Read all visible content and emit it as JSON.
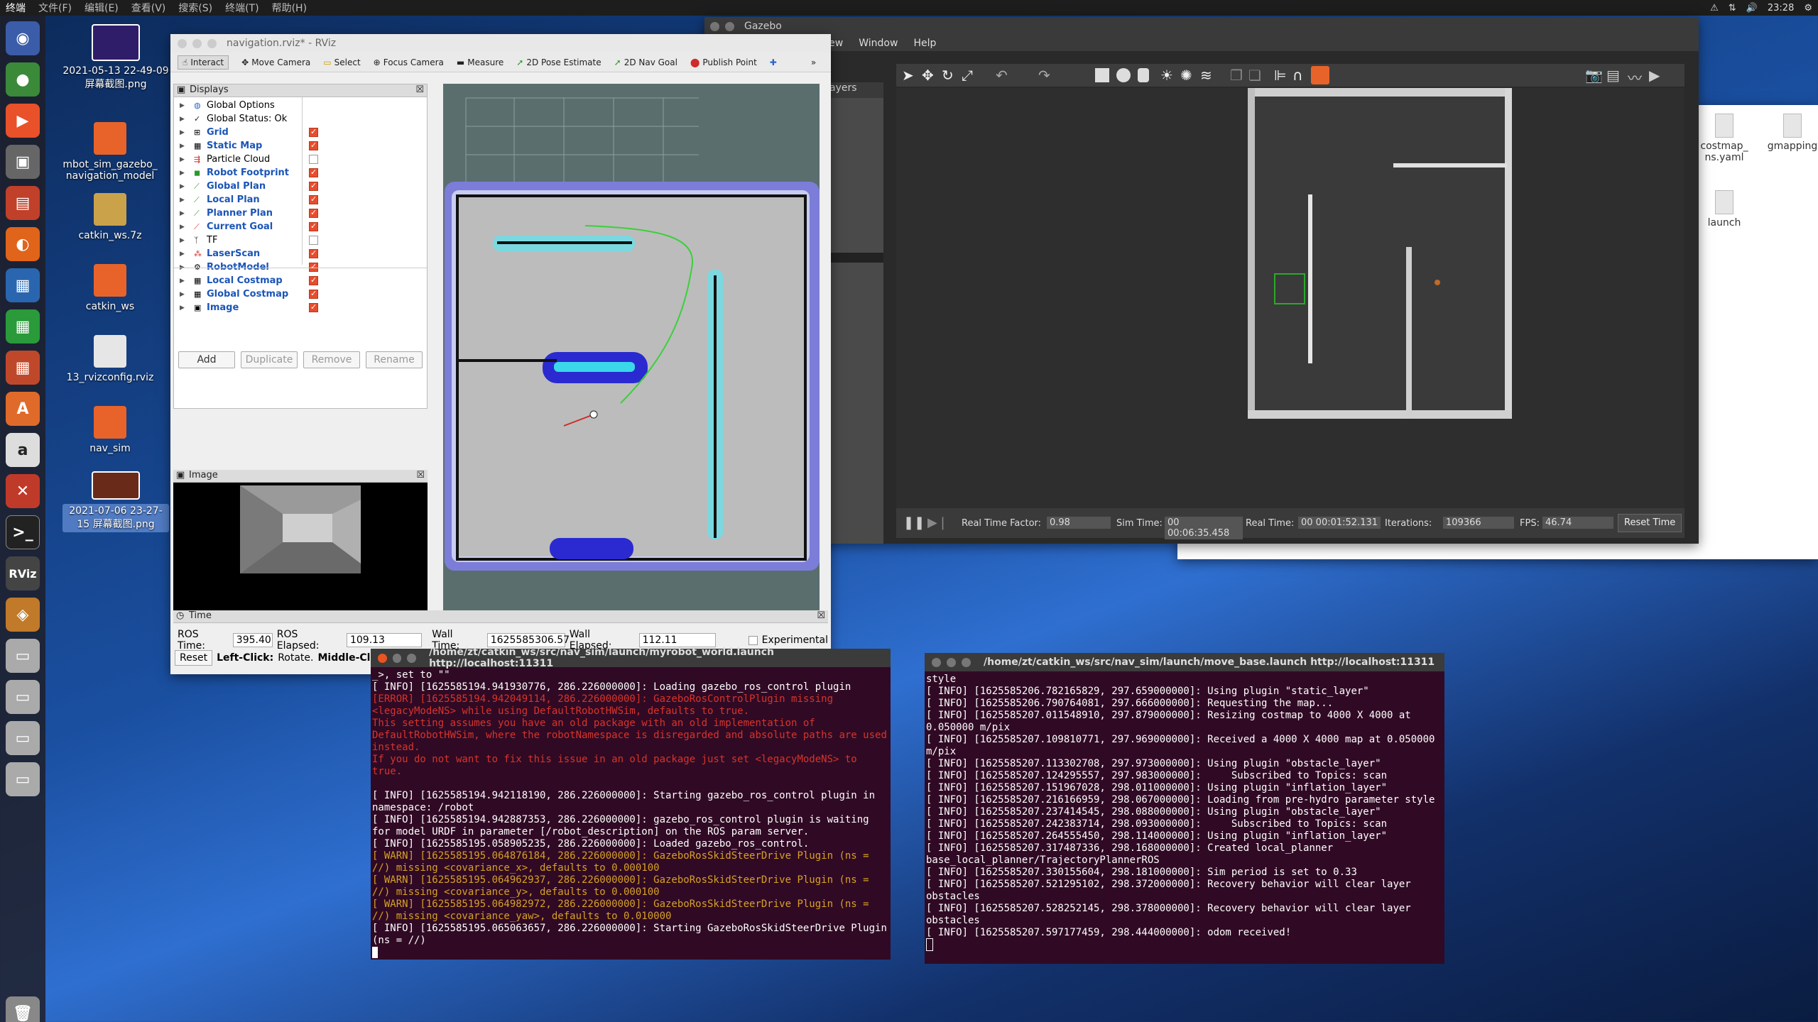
{
  "topbar": {
    "app": "终端",
    "menus": [
      "终端",
      "文件(F)",
      "编辑(E)",
      "查看(V)",
      "搜索(S)",
      "终端(T)",
      "帮助(H)"
    ],
    "time": "23:28"
  },
  "desktop": {
    "icons": [
      {
        "label": "2021-05-13 22-49-09 屏幕截图.png"
      },
      {
        "label": "mbot_sim_gazebo_ navigation_model"
      },
      {
        "label": "catkin_ws.7z"
      },
      {
        "label": "catkin_ws"
      },
      {
        "label": "13_rvizconfig.rviz"
      },
      {
        "label": "nav_sim"
      },
      {
        "label": "2021-07-06 23-27-15 屏幕截图.png"
      }
    ],
    "right_icons": [
      {
        "label": "costmap_ ns.yaml"
      },
      {
        "label": "gmapping"
      },
      {
        "label": "launch"
      }
    ]
  },
  "rviz": {
    "title": "navigation.rviz* - RViz",
    "tools": [
      "Interact",
      "Move Camera",
      "Select",
      "Focus Camera",
      "Measure",
      "2D Pose Estimate",
      "2D Nav Goal",
      "Publish Point"
    ],
    "displays_title": "Displays",
    "displays": [
      {
        "name": "Global Options",
        "checked": null,
        "blue": false
      },
      {
        "name": "Global Status: Ok",
        "checked": null,
        "blue": false
      },
      {
        "name": "Grid",
        "checked": true,
        "blue": true
      },
      {
        "name": "Static Map",
        "checked": true,
        "blue": true
      },
      {
        "name": "Particle Cloud",
        "checked": false,
        "blue": false
      },
      {
        "name": "Robot Footprint",
        "checked": true,
        "blue": true
      },
      {
        "name": "Global Plan",
        "checked": true,
        "blue": true
      },
      {
        "name": "Local Plan",
        "checked": true,
        "blue": true
      },
      {
        "name": "Planner Plan",
        "checked": true,
        "blue": true
      },
      {
        "name": "Current Goal",
        "checked": true,
        "blue": true
      },
      {
        "name": "TF",
        "checked": false,
        "blue": false
      },
      {
        "name": "LaserScan",
        "checked": true,
        "blue": true
      },
      {
        "name": "RobotModel",
        "checked": true,
        "blue": true
      },
      {
        "name": "Local Costmap",
        "checked": true,
        "blue": true
      },
      {
        "name": "Global Costmap",
        "checked": true,
        "blue": true
      },
      {
        "name": "Image",
        "checked": true,
        "blue": true
      }
    ],
    "buttons": {
      "add": "Add",
      "duplicate": "Duplicate",
      "remove": "Remove",
      "rename": "Rename"
    },
    "image_panel_title": "Image",
    "time_panel_title": "Time",
    "time": {
      "ros_time_label": "ROS Time:",
      "ros_time": "395.40",
      "ros_elapsed_label": "ROS Elapsed:",
      "ros_elapsed": "109.13",
      "wall_time_label": "Wall Time:",
      "wall_time": "1625585306.57",
      "wall_elapsed_label": "Wall Elapsed:",
      "wall_elapsed": "112.11",
      "experimental": "Experimental"
    },
    "status": {
      "reset": "Reset",
      "hint_bold": "Left-Click:",
      "hint_1": "Rotate.",
      "hint_bold2": "Middle-Click:"
    }
  },
  "gazebo": {
    "title": "Gazebo",
    "menus": [
      "View",
      "Window",
      "Help"
    ],
    "side_label": "ayers",
    "status": {
      "rtf_label": "Real Time Factor:",
      "rtf": "0.98",
      "sim_label": "Sim Time:",
      "sim": "00 00:06:35.458",
      "real_label": "Real Time:",
      "real": "00 00:01:52.131",
      "iter_label": "Iterations:",
      "iter": "109366",
      "fps_label": "FPS:",
      "fps": "46.74",
      "reset": "Reset Time"
    }
  },
  "term1": {
    "title": "/home/zt/catkin_ws/src/nav_sim/launch/myrobot_world.launch http://localhost:11311",
    "lines": [
      {
        "t": "_>, set to \"\"",
        "c": ""
      },
      {
        "t": "[ INFO] [1625585194.941930776, 286.226000000]: Loading gazebo_ros_control plugin",
        "c": ""
      },
      {
        "t": "[ERROR] [1625585194.942049114, 286.226000000]: GazeboRosControlPlugin missing <legacyModeNS> while using DefaultRobotHWSim, defaults to true.",
        "c": "err"
      },
      {
        "t": "This setting assumes you have an old package with an old implementation of DefaultRobotHWSim, where the robotNamespace is disregarded and absolute paths are used instead.",
        "c": "err"
      },
      {
        "t": "If you do not want to fix this issue in an old package just set <legacyModeNS> to true.",
        "c": "err"
      },
      {
        "t": "",
        "c": ""
      },
      {
        "t": "[ INFO] [1625585194.942118190, 286.226000000]: Starting gazebo_ros_control plugin in namespace: /robot",
        "c": ""
      },
      {
        "t": "[ INFO] [1625585194.942887353, 286.226000000]: gazebo_ros_control plugin is waiting for model URDF in parameter [/robot_description] on the ROS param server.",
        "c": ""
      },
      {
        "t": "[ INFO] [1625585195.058905235, 286.226000000]: Loaded gazebo_ros_control.",
        "c": ""
      },
      {
        "t": "[ WARN] [1625585195.064876184, 286.226000000]: GazeboRosSkidSteerDrive Plugin (ns = //) missing <covariance_x>, defaults to 0.000100",
        "c": "warn"
      },
      {
        "t": "[ WARN] [1625585195.064962937, 286.226000000]: GazeboRosSkidSteerDrive Plugin (ns = //) missing <covariance_y>, defaults to 0.000100",
        "c": "warn"
      },
      {
        "t": "[ WARN] [1625585195.064982972, 286.226000000]: GazeboRosSkidSteerDrive Plugin (ns = //) missing <covariance_yaw>, defaults to 0.010000",
        "c": "warn"
      },
      {
        "t": "[ INFO] [1625585195.065063657, 286.226000000]: Starting GazeboRosSkidSteerDrive Plugin (ns = //)",
        "c": ""
      }
    ]
  },
  "term2": {
    "title": "/home/zt/catkin_ws/src/nav_sim/launch/move_base.launch http://localhost:11311",
    "lines": [
      {
        "t": "style",
        "c": ""
      },
      {
        "t": "[ INFO] [1625585206.782165829, 297.659000000]: Using plugin \"static_layer\"",
        "c": ""
      },
      {
        "t": "[ INFO] [1625585206.790764081, 297.666000000]: Requesting the map...",
        "c": ""
      },
      {
        "t": "[ INFO] [1625585207.011548910, 297.879000000]: Resizing costmap to 4000 X 4000 at 0.050000 m/pix",
        "c": ""
      },
      {
        "t": "[ INFO] [1625585207.109810771, 297.969000000]: Received a 4000 X 4000 map at 0.050000 m/pix",
        "c": ""
      },
      {
        "t": "[ INFO] [1625585207.113302708, 297.973000000]: Using plugin \"obstacle_layer\"",
        "c": ""
      },
      {
        "t": "[ INFO] [1625585207.124295557, 297.983000000]:     Subscribed to Topics: scan",
        "c": ""
      },
      {
        "t": "[ INFO] [1625585207.151967028, 298.011000000]: Using plugin \"inflation_layer\"",
        "c": ""
      },
      {
        "t": "[ INFO] [1625585207.216166959, 298.067000000]: Loading from pre-hydro parameter style",
        "c": ""
      },
      {
        "t": "[ INFO] [1625585207.237414545, 298.088000000]: Using plugin \"obstacle_layer\"",
        "c": ""
      },
      {
        "t": "[ INFO] [1625585207.242383714, 298.093000000]:     Subscribed to Topics: scan",
        "c": ""
      },
      {
        "t": "[ INFO] [1625585207.264555450, 298.114000000]: Using plugin \"inflation_layer\"",
        "c": ""
      },
      {
        "t": "[ INFO] [1625585207.317487336, 298.168000000]: Created local_planner base_local_planner/TrajectoryPlannerROS",
        "c": ""
      },
      {
        "t": "[ INFO] [1625585207.330155604, 298.181000000]: Sim period is set to 0.33",
        "c": ""
      },
      {
        "t": "[ INFO] [1625585207.521295102, 298.372000000]: Recovery behavior will clear layer obstacles",
        "c": ""
      },
      {
        "t": "[ INFO] [1625585207.528252145, 298.378000000]: Recovery behavior will clear layer obstacles",
        "c": ""
      },
      {
        "t": "[ INFO] [1625585207.597177459, 298.444000000]: odom received!",
        "c": ""
      }
    ]
  }
}
